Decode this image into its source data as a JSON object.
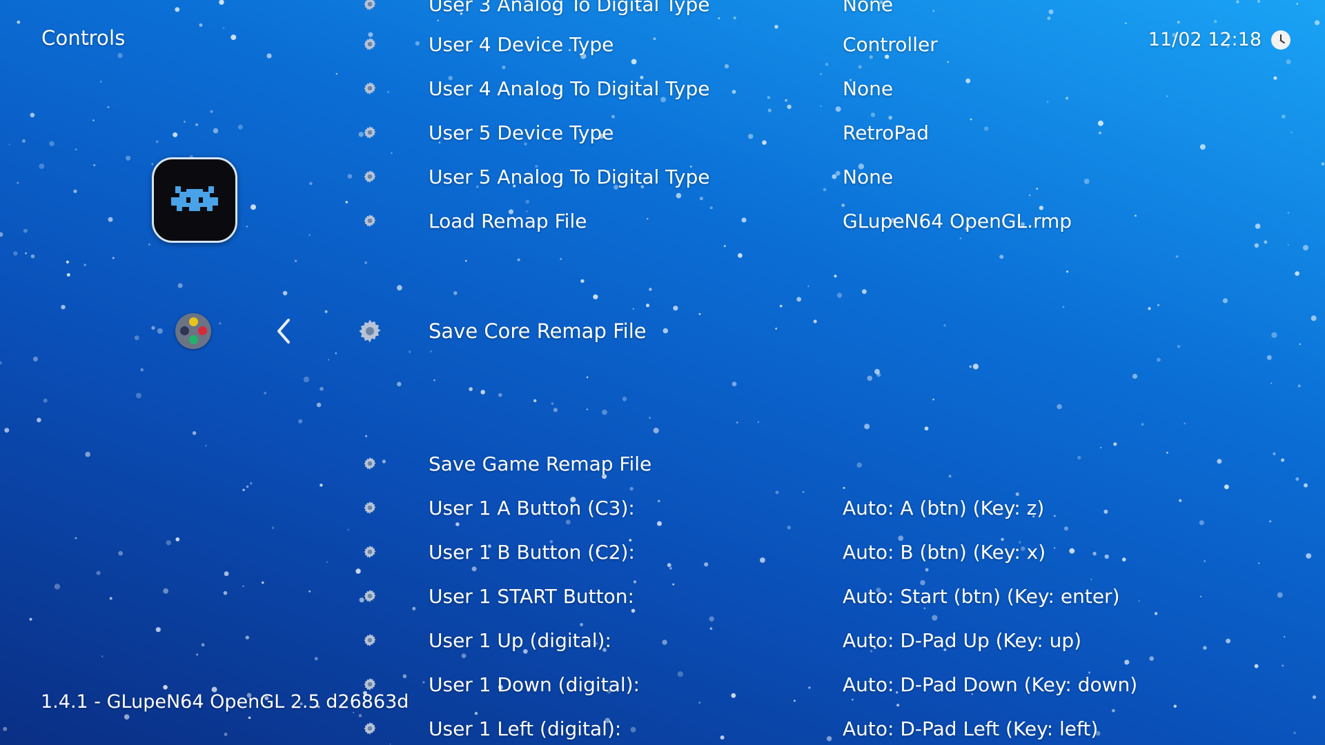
{
  "header": {
    "title": "Controls",
    "datetime": "11/02 12:18",
    "clock_icon": "clock-icon"
  },
  "sidebar": {
    "logo_icon": "retroarch-invader-icon",
    "controller_icon": "controller-icon",
    "back_icon": "chevron-left-icon"
  },
  "menu": {
    "items": [
      {
        "label": "User 3 Analog To Digital Type",
        "value": "None"
      },
      {
        "label": "User 4 Device Type",
        "value": "Controller"
      },
      {
        "label": "User 4 Analog To Digital Type",
        "value": "None"
      },
      {
        "label": "User 5 Device Type",
        "value": "RetroPad"
      },
      {
        "label": "User 5 Analog To Digital Type",
        "value": "None"
      },
      {
        "label": "Load Remap File",
        "value": "GLupeN64 OpenGL.rmp"
      },
      {
        "label": "Save Core Remap File",
        "value": "",
        "selected": true
      },
      {
        "label": "Save Game Remap File",
        "value": ""
      },
      {
        "label": "User 1 A Button (C3):",
        "value": "Auto: A (btn) (Key: z)"
      },
      {
        "label": "User 1 B Button (C2):",
        "value": "Auto: B (btn) (Key: x)"
      },
      {
        "label": "User 1 START Button:",
        "value": "Auto: Start (btn) (Key: enter)"
      },
      {
        "label": "User 1 Up (digital):",
        "value": "Auto:  D-Pad Up (Key: up)"
      },
      {
        "label": "User 1 Down (digital):",
        "value": "Auto:  D-Pad Down (Key: down)"
      },
      {
        "label": "User 1 Left (digital):",
        "value": "Auto:  D-Pad Left (Key: left)"
      }
    ]
  },
  "footer": {
    "version": "1.4.1 - GLupeN64 OpenGL 2.5 d26863d"
  },
  "colors": {
    "background_top": "#1aa3f5",
    "background_bottom": "#0a2f85",
    "text": "#ffffff",
    "gear": "#b8c4d6"
  }
}
